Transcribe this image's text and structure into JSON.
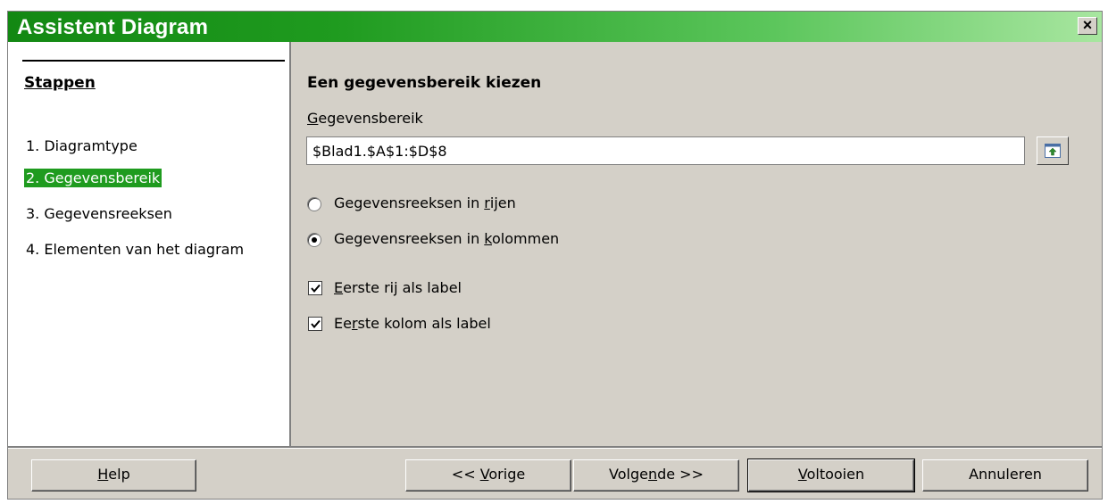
{
  "window": {
    "title": "Assistent Diagram",
    "close_label": "×"
  },
  "steps": {
    "heading": "Stappen",
    "items": [
      {
        "label": "1. Diagramtype",
        "active": false
      },
      {
        "label": "2. Gegevensbereik",
        "active": true
      },
      {
        "label": "3. Gegevensreeksen",
        "active": false
      },
      {
        "label": "4. Elementen van het diagram",
        "active": false
      }
    ]
  },
  "content": {
    "title": "Een gegevensbereik kiezen",
    "range_label_first": "G",
    "range_label_rest": "egevensbereik",
    "range_value": "$Blad1.$A$1:$D$8",
    "radio_rows_prefix": "Gegevensreeksen in ",
    "radio_rows_u": "r",
    "radio_rows_rest": "ijen",
    "radio_cols_prefix": "Gegevensreeksen in ",
    "radio_cols_u": "k",
    "radio_cols_rest": "olommen",
    "check_row_u": "E",
    "check_row_rest": "erste rij als label",
    "check_col_prefix": "Ee",
    "check_col_u": "r",
    "check_col_rest": "ste kolom als label",
    "radio_selected": "columns",
    "first_row_label_checked": true,
    "first_col_label_checked": true
  },
  "buttons": {
    "help_u": "H",
    "help_rest": "elp",
    "prev_prefix": "<< ",
    "prev_u": "V",
    "prev_rest": "orige",
    "next_prefix": "Volge",
    "next_u": "n",
    "next_rest": "de >>",
    "finish_u": "V",
    "finish_rest": "oltooien",
    "cancel": "Annuleren"
  },
  "colors": {
    "title_gradient_start": "#138813",
    "title_gradient_end": "#a8e6a0",
    "active_step_bg": "#1f9b1f",
    "dialog_bg": "#d4d0c8"
  },
  "icons": {
    "shrink": "shrink-range-icon",
    "close": "close-icon"
  }
}
